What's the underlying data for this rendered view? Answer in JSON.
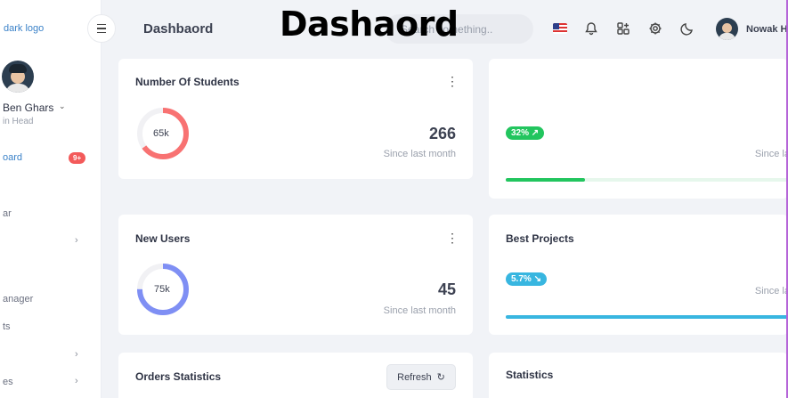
{
  "sidebar": {
    "logo": "dark logo",
    "user_name": "Ben Ghars",
    "user_role": "in Head",
    "badge": "9+",
    "items": [
      {
        "label": "oard"
      },
      {
        "label": "ar"
      },
      {
        "label": "anager"
      },
      {
        "label": "ts"
      },
      {
        "label": "es"
      }
    ]
  },
  "header": {
    "title": "Dashbaord",
    "overlay_title": "Dashaord",
    "search_placeholder": "Search something..",
    "user_name": "Nowak H"
  },
  "cards": {
    "students": {
      "title": "Number Of Students",
      "donut_label": "65k",
      "donut_fraction": 0.65,
      "donut_color": "#f87272",
      "value": "266",
      "sub": "Since last month"
    },
    "top_right": {
      "badge": "32%",
      "badge_color": "#22c55e",
      "sub": "Since la",
      "progress_fraction": 0.28,
      "progress_color": "#22c55e"
    },
    "new_users": {
      "title": "New Users",
      "donut_label": "75k",
      "donut_fraction": 0.75,
      "donut_color": "#7f8ff4",
      "value": "45",
      "sub": "Since last month"
    },
    "best_projects": {
      "title": "Best Projects",
      "badge": "5.7%",
      "badge_color": "#38b6e0",
      "sub": "Since la",
      "progress_fraction": 1.0,
      "progress_color": "#38b6e0"
    },
    "orders": {
      "title": "Orders Statistics",
      "refresh_label": "Refresh"
    },
    "statistics": {
      "title": "Statistics"
    }
  }
}
